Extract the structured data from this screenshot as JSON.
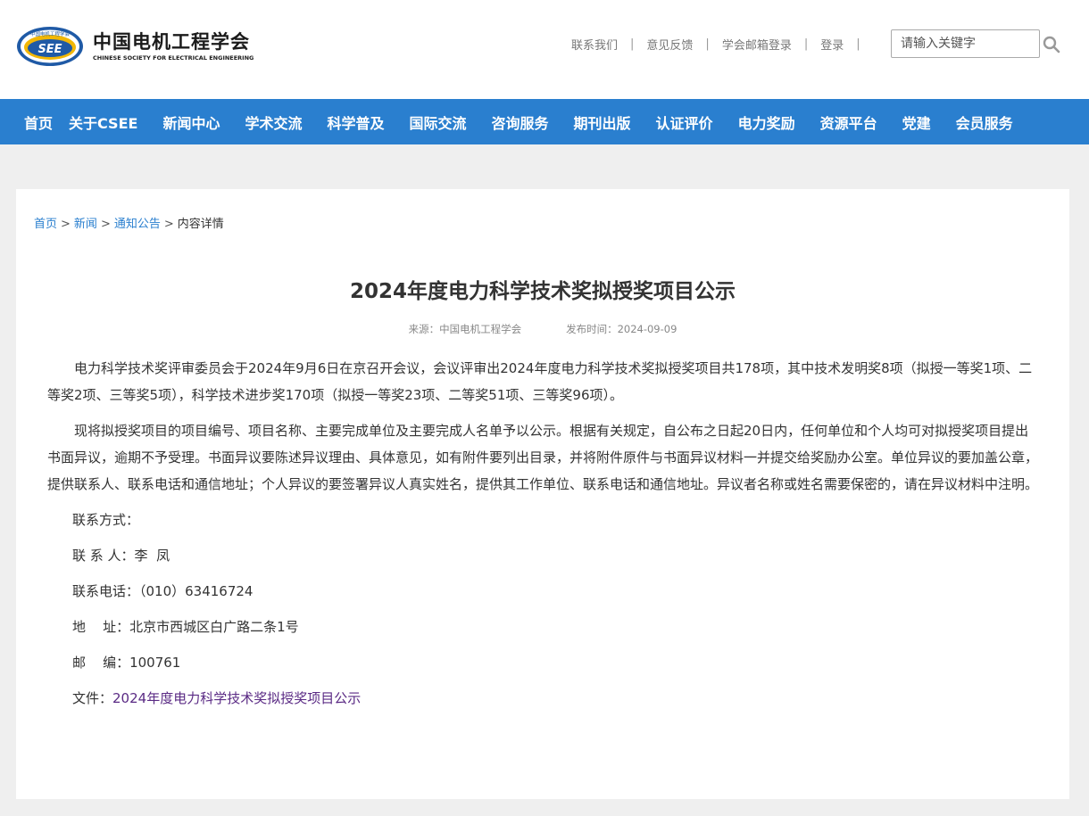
{
  "header": {
    "logo": {
      "emblem_text_top": "中国电机工程学会",
      "emblem_abbr": "SEE",
      "name_cn": "中国电机工程学会",
      "name_en": "CHINESE SOCIETY FOR ELECTRICAL ENGINEERING"
    },
    "links": [
      "联系我们",
      "意见反馈",
      "学会邮箱登录",
      "登录"
    ],
    "separator": "|",
    "search": {
      "placeholder": "请输入关键字",
      "icon": "search-icon"
    }
  },
  "nav": {
    "items": [
      "首页",
      "关于CSEE",
      "新闻中心",
      "学术交流",
      "科学普及",
      "国际交流",
      "咨询服务",
      "期刊出版",
      "认证评价",
      "电力奖励",
      "资源平台",
      "党建",
      "会员服务"
    ]
  },
  "breadcrumb": {
    "items": [
      "首页",
      "新闻",
      "通知公告",
      "内容详情"
    ],
    "separator": ">"
  },
  "article": {
    "title": "2024年度电力科学技术奖拟授奖项目公示",
    "source_label": "来源：中国电机工程学会",
    "date_label": "发布时间：2024-09-09",
    "paragraphs": [
      "电力科学技术奖评审委员会于2024年9月6日在京召开会议，会议评审出2024年度电力科学技术奖拟授奖项目共178项，其中技术发明奖8项（拟授一等奖1项、二等奖2项、三等奖5项），科学技术进步奖170项（拟授一等奖23项、二等奖51项、三等奖96项）。",
      "现将拟授奖项目的项目编号、项目名称、主要完成单位及主要完成人名单予以公示。根据有关规定，自公布之日起20日内，任何单位和个人均可对拟授奖项目提出书面异议，逾期不予受理。书面异议要陈述异议理由、具体意见，如有附件要列出目录，并将附件原件与书面异议材料一并提交给奖励办公室。单位异议的要加盖公章，提供联系人、联系电话和通信地址；个人异议的要签署异议人真实姓名，提供其工作单位、联系电话和通信地址。异议者名称或姓名需要保密的，请在异议材料中注明。"
    ],
    "contact_heading": "联系方式：",
    "contact_person": "联 系 人：李  凤",
    "contact_phone": "联系电话：（010）63416724",
    "contact_address": "地    址：北京市西城区白广路二条1号",
    "contact_postcode": "邮    编：100761",
    "file_label": "文件：",
    "file_link": "2024年度电力科学技术奖拟授奖项目公示"
  },
  "colors": {
    "nav_bg": "#2a7fcf",
    "link_blue": "#2a7fcf",
    "file_link": "#5a2a84",
    "page_bg": "#efefef"
  }
}
